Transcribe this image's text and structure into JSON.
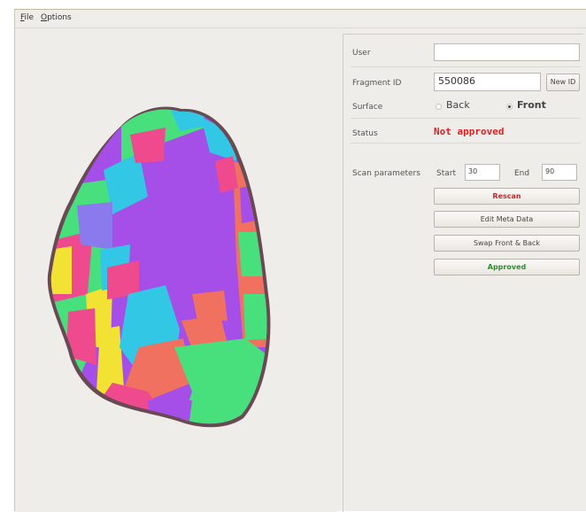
{
  "menubar": {
    "items": [
      "File",
      "Options"
    ]
  },
  "form": {
    "user_label": "User",
    "user_value": "",
    "fragment_label": "Fragment ID",
    "fragment_value": "550086",
    "new_id_label": "New ID",
    "surface_label": "Surface",
    "surface_options": [
      "Back",
      "Front"
    ],
    "surface_selected": "Front",
    "status_label": "Status",
    "status_value": "Not approved",
    "scan_label": "Scan parameters",
    "start_label": "Start",
    "start_value": "30",
    "end_label": "End",
    "end_value": "90"
  },
  "actions": {
    "rescan": "Rescan",
    "edit_meta": "Edit Meta Data",
    "swap": "Swap Front & Back",
    "approved": "Approved"
  },
  "colors": {
    "status_red": "#e02020",
    "rescan_red": "#c62828",
    "approved_green": "#2e8b2e",
    "patch_purple": "#a54ee8",
    "patch_cyan": "#33c7e6",
    "patch_green": "#47e07c",
    "patch_pink": "#ef4a8e",
    "patch_yellow": "#f2e233",
    "patch_salmon": "#f0715f"
  },
  "viewport": {
    "object_icon": "3d-fragment-mesh"
  }
}
